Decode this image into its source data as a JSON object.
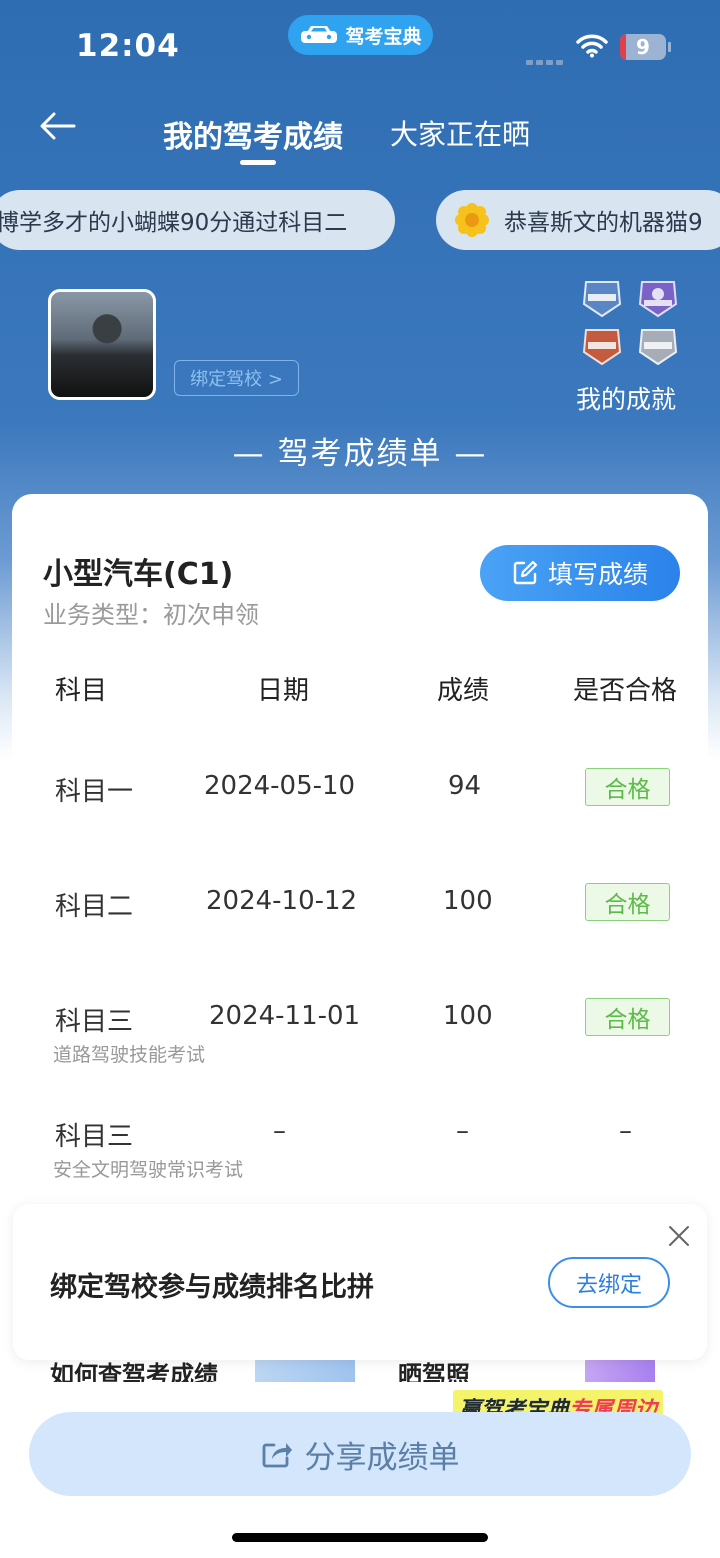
{
  "status_bar": {
    "time": "12:04",
    "app_name": "驾考宝典",
    "battery": "9"
  },
  "nav": {
    "active_tab": "我的驾考成绩",
    "other_tab": "大家正在晒"
  },
  "marquee": [
    "博学多才的小蝴蝶90分通过科目二",
    "恭喜斯文的机器猫9"
  ],
  "profile": {
    "bind_school_label": "绑定驾校 >",
    "achievements_label": "我的成就"
  },
  "report_title": "— 驾考成绩单 —",
  "card": {
    "vehicle": "小型汽车(C1)",
    "business_type": "业务类型：初次申领",
    "fill_button": "填写成绩",
    "columns": [
      "科目",
      "日期",
      "成绩",
      "是否合格"
    ],
    "rows": [
      {
        "subject": "科目一",
        "sub": "",
        "date": "2024-05-10",
        "score": "94",
        "status": "合格"
      },
      {
        "subject": "科目二",
        "sub": "",
        "date": "2024-10-12",
        "score": "100",
        "status": "合格"
      },
      {
        "subject": "科目三",
        "sub": "道路驾驶技能考试",
        "date": "2024-11-01",
        "score": "100",
        "status": "合格"
      },
      {
        "subject": "科目三",
        "sub": "安全文明驾驶常识考试",
        "date": "–",
        "score": "–",
        "status": "–"
      }
    ]
  },
  "popup": {
    "text": "绑定驾校参与成绩排名比拼",
    "button": "去绑定"
  },
  "bottom": {
    "peek_left": "如何查驾考成绩",
    "peek_right": "晒驾照",
    "promo_a": "赢驾考宝典",
    "promo_b": "专属周边",
    "share_button": "分享成绩单"
  },
  "colors": {
    "header_blue": "#2f6db3",
    "accent_blue": "#2b82ea",
    "pass_green": "#5cba49"
  }
}
